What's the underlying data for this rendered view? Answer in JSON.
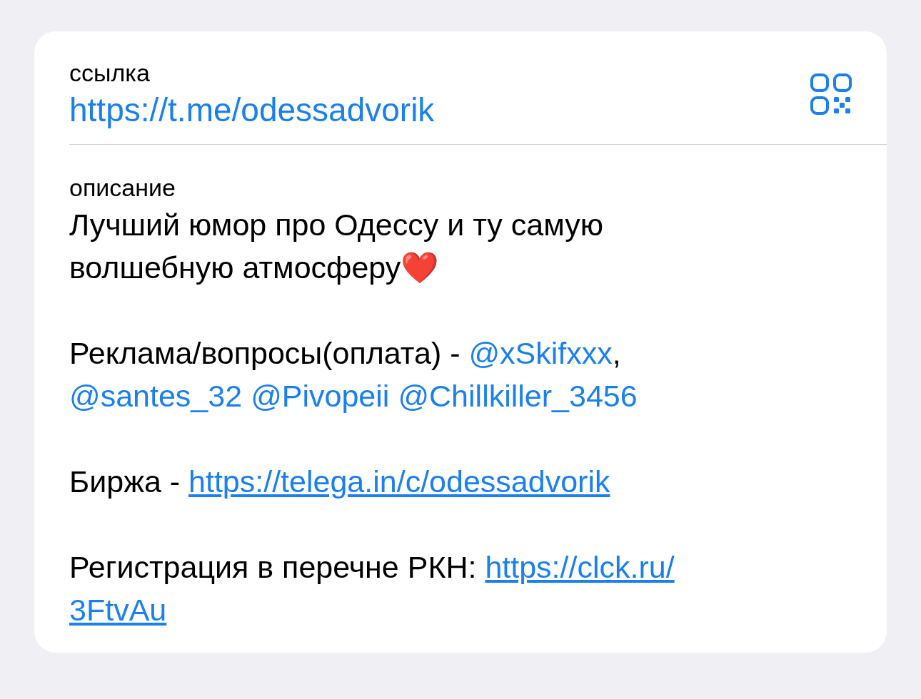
{
  "link_section": {
    "label": "ссылка",
    "url": "https://t.me/odessadvorik"
  },
  "description_section": {
    "label": "описание",
    "paragraphs": [
      {
        "lines": [
          [
            {
              "kind": "text",
              "text": "Лучший юмор про Одессу и ту самую"
            }
          ],
          [
            {
              "kind": "text",
              "text": "волшебную атмосферу"
            },
            {
              "kind": "emoji",
              "text": "❤️"
            }
          ]
        ]
      },
      {
        "lines": [
          [
            {
              "kind": "text",
              "text": "Реклама/вопросы(оплата) - "
            },
            {
              "kind": "mention",
              "text": "@xSkifxxx"
            },
            {
              "kind": "text",
              "text": ","
            }
          ],
          [
            {
              "kind": "mention",
              "text": "@santes_32"
            },
            {
              "kind": "mention",
              "text": "@Pivopeii"
            },
            {
              "kind": "mention",
              "text": "@Chillkiller_3456"
            }
          ]
        ]
      },
      {
        "lines": [
          [
            {
              "kind": "text",
              "text": "Биржа - "
            },
            {
              "kind": "link",
              "text": "https://telega.in/c/odessadvorik"
            }
          ]
        ]
      },
      {
        "lines": [
          [
            {
              "kind": "text",
              "text": "Регистрация в перечне РКН: "
            },
            {
              "kind": "link",
              "text": "https://clck.ru/"
            }
          ],
          [
            {
              "kind": "link",
              "text": "3FtvAu"
            }
          ]
        ]
      }
    ]
  }
}
